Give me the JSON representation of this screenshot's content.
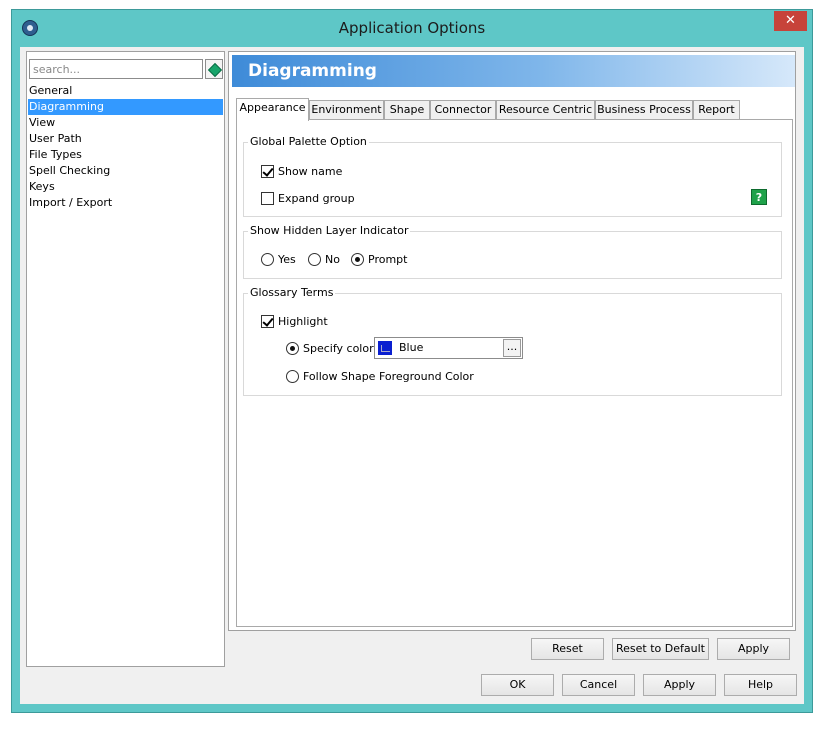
{
  "window": {
    "title": "Application Options",
    "close_glyph": "✕",
    "icon": "app-gear-icon"
  },
  "search": {
    "placeholder": "search..."
  },
  "sidebar": {
    "items": [
      {
        "label": "General"
      },
      {
        "label": "Diagramming",
        "selected": true
      },
      {
        "label": "View"
      },
      {
        "label": "User Path"
      },
      {
        "label": "File Types"
      },
      {
        "label": "Spell Checking"
      },
      {
        "label": "Keys"
      },
      {
        "label": "Import / Export"
      }
    ]
  },
  "panel": {
    "title": "Diagramming"
  },
  "tabs": [
    {
      "label": "Appearance",
      "active": true
    },
    {
      "label": "Environment"
    },
    {
      "label": "Shape"
    },
    {
      "label": "Connector"
    },
    {
      "label": "Resource Centric"
    },
    {
      "label": "Business Process"
    },
    {
      "label": "Report"
    }
  ],
  "global_palette": {
    "title": "Global Palette Option",
    "show_name": {
      "label": "Show name",
      "checked": true
    },
    "expand_group": {
      "label": "Expand group",
      "checked": false
    },
    "help_glyph": "?"
  },
  "hidden_layer": {
    "title": "Show Hidden Layer Indicator",
    "options": [
      {
        "label": "Yes",
        "selected": false
      },
      {
        "label": "No",
        "selected": false
      },
      {
        "label": "Prompt",
        "selected": true
      }
    ]
  },
  "glossary": {
    "title": "Glossary Terms",
    "highlight": {
      "label": "Highlight",
      "checked": true
    },
    "specify_color": {
      "label": "Specify color",
      "selected": true
    },
    "color_value": "Blue",
    "color_swatch": "#0a1fd0",
    "browse_label": "...",
    "follow_shape": {
      "label": "Follow Shape Foreground Color",
      "selected": false
    }
  },
  "panel_buttons": {
    "reset": "Reset",
    "reset_default": "Reset to Default",
    "apply": "Apply"
  },
  "dialog_buttons": {
    "ok": "OK",
    "cancel": "Cancel",
    "apply": "Apply",
    "help": "Help"
  }
}
